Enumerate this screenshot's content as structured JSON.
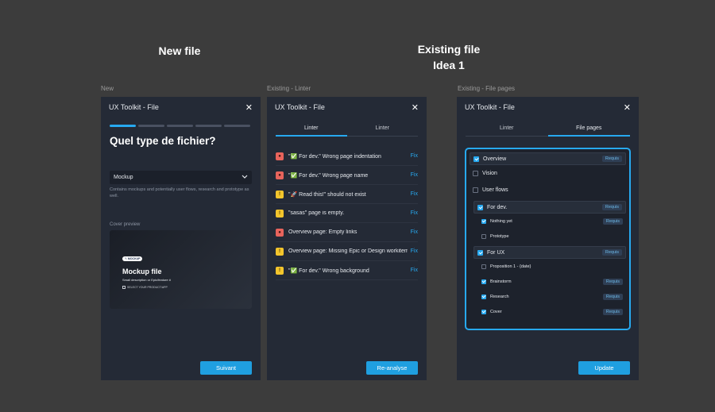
{
  "headings": {
    "new_file": "New file",
    "existing_file_line1": "Existing file",
    "existing_file_line2": "Idea 1"
  },
  "frames": {
    "new_label": "New",
    "linter_label": "Existing - Linter",
    "pages_label": "Existing - File pages"
  },
  "new_panel": {
    "title": "UX Toolkit - File",
    "progress": {
      "total_steps": 5,
      "current_step": 1
    },
    "question": "Quel type de fichier?",
    "select": {
      "value": "Mockup",
      "description": "Contains mockups and potentially user flows, research and prototype as well."
    },
    "cover_label": "Cover preview",
    "cover": {
      "tag": "MOCKUP",
      "title": "Mockup file",
      "subtitle": "Small description or Epic/feature #",
      "checkbox": "SELECT YOUR PRODUCT/APP"
    },
    "next_button": "Suivant"
  },
  "linter_panel": {
    "title": "UX Toolkit - File",
    "tabs": [
      "Linter",
      "Linter"
    ],
    "active_tab": 0,
    "issues": [
      {
        "level": "error",
        "text": "\"✅ For dev.\" Wrong page indentation",
        "fix": "Fix"
      },
      {
        "level": "error",
        "text": "\"✅ For dev.\" Wrong page name",
        "fix": "Fix"
      },
      {
        "level": "warn",
        "text": "\"🚀 Read this!\" should not exist",
        "fix": "Fix"
      },
      {
        "level": "warn",
        "text": "\"sasas\" page is empty.",
        "fix": "Fix"
      },
      {
        "level": "error",
        "text": "Overview page: Empty links",
        "fix": "Fix"
      },
      {
        "level": "warn",
        "text": "Overview page: Missing Epic or Design workitem",
        "fix": "Fix"
      },
      {
        "level": "warn",
        "text": "\"✅ For dev.\" Wrong background",
        "fix": "Fix"
      }
    ],
    "reanalyse_button": "Re-analyse"
  },
  "pages_panel": {
    "title": "UX Toolkit - File",
    "tabs": [
      "Linter",
      "File pages"
    ],
    "active_tab": 1,
    "requis_label": "Requis",
    "pages": [
      {
        "label": "Overview",
        "checked": true,
        "requis": true
      },
      {
        "label": "Vision",
        "checked": false,
        "requis": false
      },
      {
        "label": "User flows",
        "checked": false,
        "requis": false
      }
    ],
    "groups": [
      {
        "label": "For dev.",
        "checked": true,
        "requis": true,
        "children": [
          {
            "label": "Nothing yet",
            "checked": true,
            "requis": true
          },
          {
            "label": "Prototype",
            "checked": false,
            "requis": false
          }
        ]
      },
      {
        "label": "For UX",
        "checked": true,
        "requis": true,
        "children": [
          {
            "label": "Proposition 1 - {date}",
            "checked": false,
            "requis": false
          },
          {
            "label": "Brainstorm",
            "checked": true,
            "requis": true
          },
          {
            "label": "Research",
            "checked": true,
            "requis": true
          },
          {
            "label": "Cover",
            "checked": true,
            "requis": true
          }
        ]
      }
    ],
    "update_button": "Update"
  },
  "colors": {
    "accent": "#27a9f0",
    "panel_bg": "#242a36",
    "canvas_bg": "#3c3c3c",
    "error": "#e8645c",
    "warn": "#f3c52c"
  }
}
